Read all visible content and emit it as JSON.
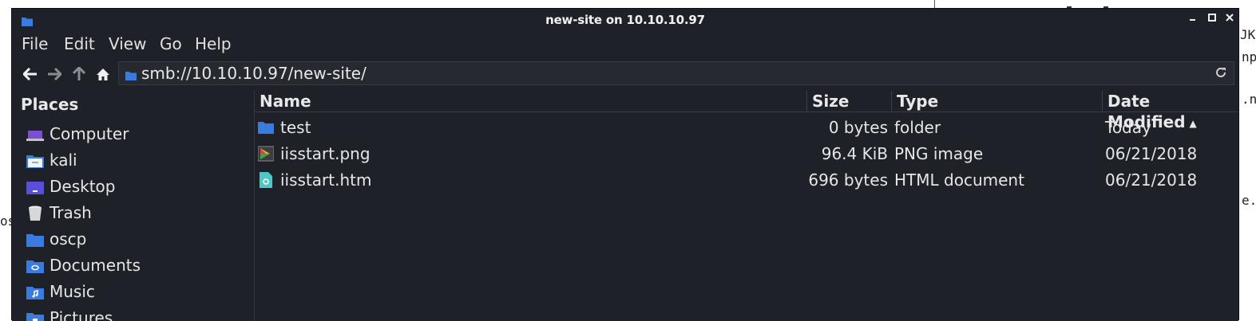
{
  "window": {
    "title": "new-site on 10.10.10.97",
    "controls": {
      "minimize": "–",
      "maximize": "▫",
      "close": "✕"
    }
  },
  "menu": {
    "items": [
      {
        "label": "File"
      },
      {
        "label": "Edit"
      },
      {
        "label": "View"
      },
      {
        "label": "Go"
      },
      {
        "label": "Help"
      }
    ]
  },
  "toolbar": {
    "location": "smb://10.10.10.97/new-site/"
  },
  "sidebar": {
    "heading": "Places",
    "items": [
      {
        "label": "Computer",
        "icon": "computer-icon"
      },
      {
        "label": "kali",
        "icon": "home-folder-icon"
      },
      {
        "label": "Desktop",
        "icon": "desktop-icon"
      },
      {
        "label": "Trash",
        "icon": "trash-icon"
      },
      {
        "label": "oscp",
        "icon": "folder-icon"
      },
      {
        "label": "Documents",
        "icon": "documents-folder-icon"
      },
      {
        "label": "Music",
        "icon": "music-folder-icon"
      },
      {
        "label": "Pictures",
        "icon": "pictures-folder-icon"
      }
    ]
  },
  "table": {
    "columns": {
      "name": "Name",
      "size": "Size",
      "type": "Type",
      "date": "Date Modified"
    },
    "sort": {
      "column": "Date Modified",
      "direction": "ascending"
    },
    "rows": [
      {
        "name": "test",
        "size": "0 bytes",
        "type": "folder",
        "date": "Today",
        "icon": "folder-icon"
      },
      {
        "name": "iisstart.png",
        "size": "96.4 KiB",
        "type": "PNG image",
        "date": "06/21/2018",
        "icon": "image-file-icon"
      },
      {
        "name": "iisstart.htm",
        "size": "696 bytes",
        "type": "HTML document",
        "date": "06/21/2018",
        "icon": "html-file-icon"
      }
    ]
  },
  "colors": {
    "window_bg": "#1e2127",
    "accent_folder": "#3a7be0",
    "text": "#e6e6e6"
  }
}
